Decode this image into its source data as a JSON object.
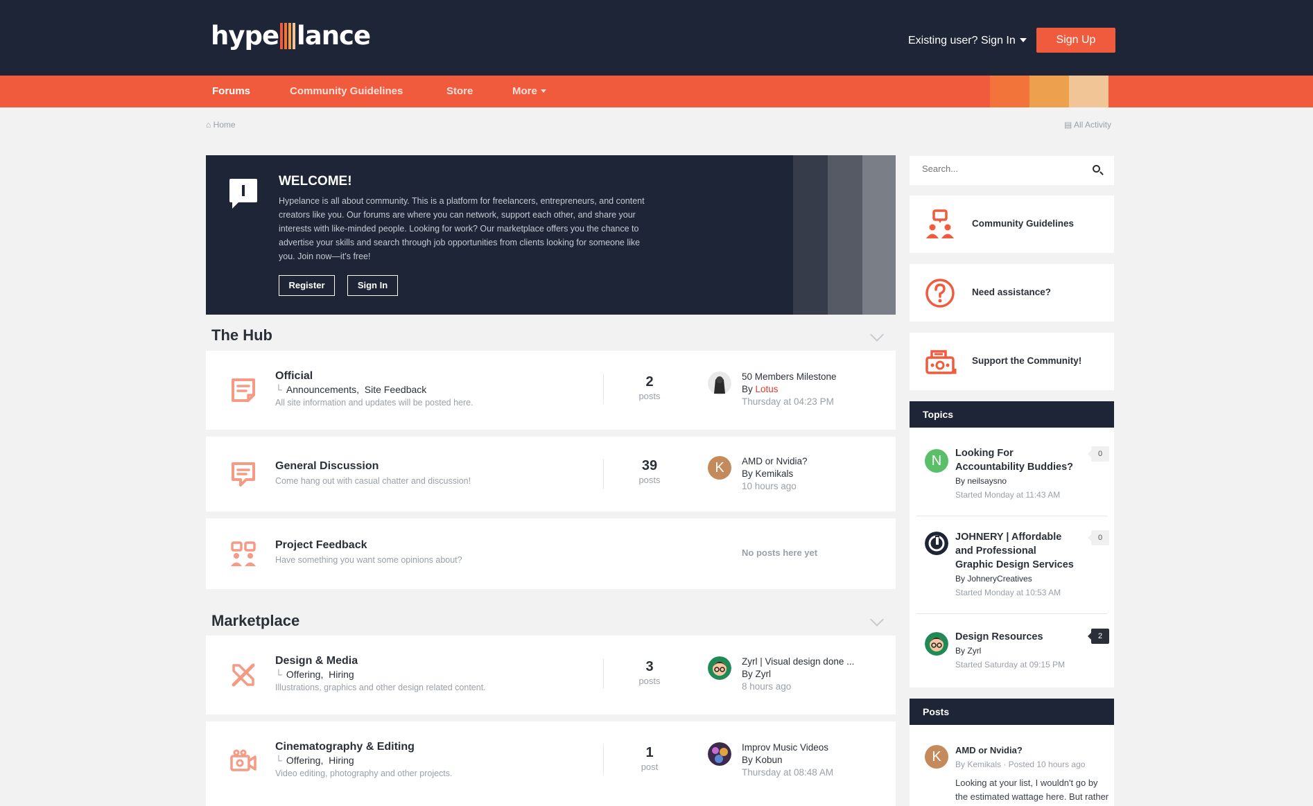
{
  "brand": {
    "logo_left": "hype",
    "logo_right": "lance",
    "colors": {
      "navy": "#1e2536",
      "accent": "#f05a3d",
      "swatch_1": "#f3743b",
      "swatch_2": "#eda14e",
      "swatch_3": "#f2c597"
    }
  },
  "header": {
    "signin_label": "Existing user? Sign In",
    "signup_label": "Sign Up"
  },
  "nav": {
    "items": [
      {
        "label": "Forums"
      },
      {
        "label": "Community Guidelines"
      },
      {
        "label": "Store"
      },
      {
        "label": "More"
      }
    ]
  },
  "breadcrumb": {
    "home": "Home",
    "all_activity": "All Activity"
  },
  "welcome": {
    "title": "WELCOME!",
    "text": "Hypelance is all about community. This is a platform for freelancers, entrepreneurs, and content creators like you. Our forums are where you can network, support each other, and share your interests with like-minded people. Looking for work? Our marketplace offers you the chance to advertise your skills and search through job opportunities from clients looking for someone like you. Join now—it’s free!",
    "register_label": "Register",
    "signin_label": "Sign In"
  },
  "sections": [
    {
      "title": "The Hub",
      "forums": [
        {
          "title": "Official",
          "subs": [
            "Announcements,",
            "Site Feedback"
          ],
          "desc": "All site information and updates will be posted here.",
          "count": "2",
          "count_label": "posts",
          "last_title": "50 Members Milestone",
          "last_by_prefix": "By",
          "last_by": "Lotus",
          "last_time": "Thursday at 04:23 PM",
          "icon": "document-icon"
        },
        {
          "title": "General Discussion",
          "desc": "Come hang out with casual chatter and discussion!",
          "count": "39",
          "count_label": "posts",
          "last_title": "AMD or Nvidia?",
          "last_by_prefix": "By",
          "last_by": "Kemikals",
          "last_time": "10 hours ago",
          "avatar_letter": "K",
          "icon": "chat-bubble-icon"
        },
        {
          "title": "Project Feedback",
          "desc": "Have something you want some opinions about?",
          "empty_label": "No posts here yet",
          "icon": "group-feedback-icon"
        }
      ]
    },
    {
      "title": "Marketplace",
      "forums": [
        {
          "title": "Design & Media",
          "subs": [
            "Offering,",
            "Hiring"
          ],
          "desc": "Illustrations, graphics and other design related content.",
          "count": "3",
          "count_label": "posts",
          "last_title": "Zyrl | Visual design done ...",
          "last_by_prefix": "By",
          "last_by": "Zyrl",
          "last_time": "8 hours ago",
          "icon": "design-tools-icon"
        },
        {
          "title": "Cinematography & Editing",
          "subs": [
            "Offering,",
            "Hiring"
          ],
          "desc": "Video editing, photography and other projects.",
          "count": "1",
          "count_label": "post",
          "last_title": "Improv Music Videos",
          "last_by_prefix": "By",
          "last_by": "Kobun",
          "last_time": "Thursday at 08:48 AM",
          "icon": "video-camera-icon"
        }
      ]
    }
  ],
  "sidebar": {
    "search_placeholder": "Search...",
    "cards": [
      {
        "label": "Community Guidelines",
        "icon": "community-icon"
      },
      {
        "label": "Need assistance?",
        "icon": "question-icon"
      },
      {
        "label": "Support the Community!",
        "icon": "cash-register-icon"
      }
    ],
    "topics": {
      "title": "Topics",
      "items": [
        {
          "title": "Looking For Accountability Buddies?",
          "by_prefix": "By",
          "by": "neilsaysno",
          "date": "Started Monday at 11:43 AM",
          "count": "0",
          "avatar_letter": "N"
        },
        {
          "title": "JOHNERY | Affordable and Professional Graphic Design Services",
          "by_prefix": "By",
          "by": "JohneryCreatives",
          "date": "Started Monday at 10:53 AM",
          "count": "0"
        },
        {
          "title": "Design Resources",
          "by_prefix": "By",
          "by": "Zyrl",
          "date": "Started Saturday at 09:15 PM",
          "count": "2"
        }
      ]
    },
    "posts": {
      "title": "Posts",
      "items": [
        {
          "title": "AMD or Nvidia?",
          "meta": "By Kemikals · Posted 10 hours ago",
          "text": "Looking at your list, I wouldn't go by the estimated wattage here. But rather",
          "avatar_letter": "K"
        }
      ]
    }
  }
}
